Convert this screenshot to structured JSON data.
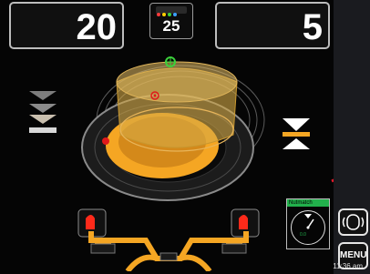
{
  "readouts": {
    "left_value": "20",
    "right_value": "5",
    "center_value": "25"
  },
  "side_buttons": {
    "tyre_icon": "tyre-profile-icon",
    "menu_label": "MENU"
  },
  "nutmatch": {
    "title": "Nutmatch",
    "value": "0.0"
  },
  "status": {
    "time": "11:36 am"
  },
  "colors": {
    "background": "#050505",
    "panel": "#1a1b1f",
    "rim_orange": "#f5a623",
    "marker_red": "#e0191b",
    "marker_green": "#3bd13b",
    "accent_red_line": "#e5192b"
  },
  "icons": [
    "chevrons-down-icon",
    "hourglass-icon",
    "tyre-profile-icon",
    "weight-clamp-icon"
  ]
}
